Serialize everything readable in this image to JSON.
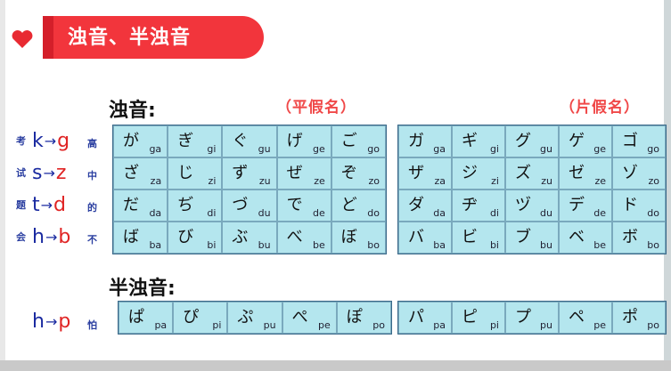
{
  "banner": {
    "title": "浊音、半浊音",
    "heart_icon": "heart-icon"
  },
  "dakuon": {
    "title": "浊音:",
    "hiragana_label": "（平假名）",
    "katakana_label": "（片假名）",
    "rules": [
      {
        "cn": "考",
        "from": "k",
        "to": "g",
        "cn2": "高"
      },
      {
        "cn": "试",
        "from": "s",
        "to": "z",
        "cn2": "中"
      },
      {
        "cn": "题",
        "from": "t",
        "to": "d",
        "cn2": "的"
      },
      {
        "cn": "会",
        "from": "h",
        "to": "b",
        "cn2": "不"
      }
    ],
    "hiragana": [
      [
        [
          "が",
          "ga"
        ],
        [
          "ぎ",
          "gi"
        ],
        [
          "ぐ",
          "gu"
        ],
        [
          "げ",
          "ge"
        ],
        [
          "ご",
          "go"
        ]
      ],
      [
        [
          "ざ",
          "za"
        ],
        [
          "じ",
          "zi"
        ],
        [
          "ず",
          "zu"
        ],
        [
          "ぜ",
          "ze"
        ],
        [
          "ぞ",
          "zo"
        ]
      ],
      [
        [
          "だ",
          "da"
        ],
        [
          "ぢ",
          "di"
        ],
        [
          "づ",
          "du"
        ],
        [
          "で",
          "de"
        ],
        [
          "ど",
          "do"
        ]
      ],
      [
        [
          "ば",
          "ba"
        ],
        [
          "び",
          "bi"
        ],
        [
          "ぶ",
          "bu"
        ],
        [
          "べ",
          "be"
        ],
        [
          "ぼ",
          "bo"
        ]
      ]
    ],
    "katakana": [
      [
        [
          "ガ",
          "ga"
        ],
        [
          "ギ",
          "gi"
        ],
        [
          "グ",
          "gu"
        ],
        [
          "ゲ",
          "ge"
        ],
        [
          "ゴ",
          "go"
        ]
      ],
      [
        [
          "ザ",
          "za"
        ],
        [
          "ジ",
          "zi"
        ],
        [
          "ズ",
          "zu"
        ],
        [
          "ゼ",
          "ze"
        ],
        [
          "ゾ",
          "zo"
        ]
      ],
      [
        [
          "ダ",
          "da"
        ],
        [
          "ヂ",
          "di"
        ],
        [
          "ヅ",
          "du"
        ],
        [
          "デ",
          "de"
        ],
        [
          "ド",
          "do"
        ]
      ],
      [
        [
          "バ",
          "ba"
        ],
        [
          "ビ",
          "bi"
        ],
        [
          "ブ",
          "bu"
        ],
        [
          "ベ",
          "be"
        ],
        [
          "ボ",
          "bo"
        ]
      ]
    ]
  },
  "handakuon": {
    "title": "半浊音:",
    "rule": {
      "from": "h",
      "to": "p",
      "cn": "怕"
    },
    "hiragana": [
      [
        "ぱ",
        "pa"
      ],
      [
        "ぴ",
        "pi"
      ],
      [
        "ぷ",
        "pu"
      ],
      [
        "ぺ",
        "pe"
      ],
      [
        "ぽ",
        "po"
      ]
    ],
    "katakana": [
      [
        "パ",
        "pa"
      ],
      [
        "ピ",
        "pi"
      ],
      [
        "プ",
        "pu"
      ],
      [
        "ペ",
        "pe"
      ],
      [
        "ポ",
        "po"
      ]
    ]
  }
}
